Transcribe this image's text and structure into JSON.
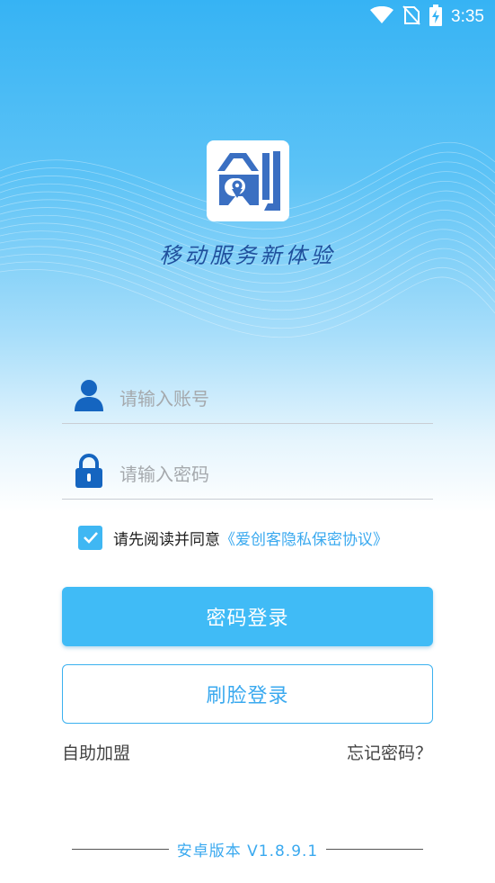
{
  "status_bar": {
    "time": "3:35",
    "icons": [
      "wifi-icon",
      "no-sim-icon",
      "battery-charging-icon"
    ]
  },
  "brand": {
    "logo_icon": "chuang-logo-icon",
    "slogan": "移动服务新体验",
    "logo_color": "#3a6fc2"
  },
  "form": {
    "account_placeholder": "请输入账号",
    "password_placeholder": "请输入密码",
    "account_icon": "user-icon",
    "password_icon": "lock-icon",
    "agree_checked": true,
    "agree_text": "请先阅读并同意",
    "agree_link": "《爱创客隐私保密协议》"
  },
  "buttons": {
    "password_login": "密码登录",
    "face_login": "刷脸登录"
  },
  "links": {
    "self_join": "自助加盟",
    "forgot_password": "忘记密码？"
  },
  "footer": {
    "version": "安卓版本 V1.8.9.1"
  },
  "colors": {
    "accent": "#40bbf6",
    "link": "#3aa9ef",
    "icon_blue": "#1565c0"
  }
}
